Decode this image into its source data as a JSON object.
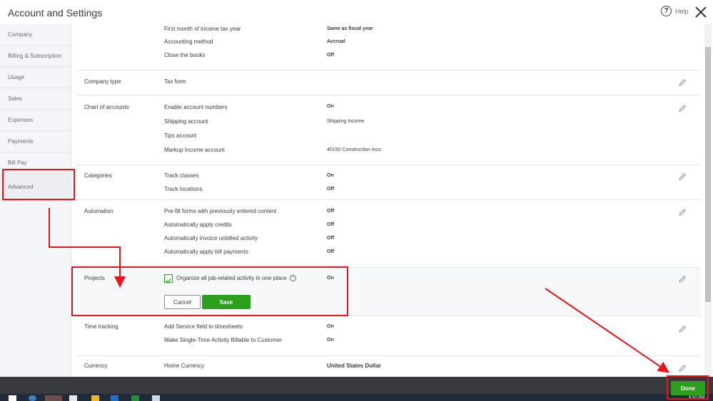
{
  "window": {
    "title": "Account and Settings",
    "help_label": "Help"
  },
  "sidebar": {
    "items": [
      {
        "label": "Company"
      },
      {
        "label": "Billing & Subscription"
      },
      {
        "label": "Usage"
      },
      {
        "label": "Sales"
      },
      {
        "label": "Expenses"
      },
      {
        "label": "Payments"
      },
      {
        "label": "Bill Pay"
      },
      {
        "label": "Advanced",
        "active": true
      }
    ]
  },
  "sections": {
    "accounting": {
      "rows": [
        {
          "label": "First month of income tax year",
          "value": "Same as fiscal year"
        },
        {
          "label": "Accounting method",
          "value": "Accrual"
        },
        {
          "label": "Close the books",
          "value": "Off"
        }
      ]
    },
    "company_type": {
      "label": "Company type",
      "rows": [
        {
          "label": "Tax form",
          "value": ""
        }
      ]
    },
    "chart_of_accounts": {
      "label": "Chart of accounts",
      "rows": [
        {
          "label": "Enable account numbers",
          "value": "On"
        },
        {
          "label": "Shipping account",
          "value": "Shipping Income"
        },
        {
          "label": "Tips account",
          "value": ""
        },
        {
          "label": "Markup income account",
          "value": "40150 Construction Inco"
        }
      ]
    },
    "categories": {
      "label": "Categories",
      "rows": [
        {
          "label": "Track classes",
          "value": "On"
        },
        {
          "label": "Track locations",
          "value": "Off"
        }
      ]
    },
    "automation": {
      "label": "Automation",
      "rows": [
        {
          "label": "Pre-fill forms with previously entered content",
          "value": "Off"
        },
        {
          "label": "Automatically apply credits",
          "value": "Off"
        },
        {
          "label": "Automatically invoice unbilled activity",
          "value": "Off"
        },
        {
          "label": "Automatically apply bill payments",
          "value": "Off"
        }
      ]
    },
    "projects": {
      "label": "Projects",
      "checkbox_label": "Organize all job-related activity in one place",
      "help_glyph": "?",
      "value": "On",
      "cancel_label": "Cancel",
      "save_label": "Save"
    },
    "time_tracking": {
      "label": "Time tracking",
      "rows": [
        {
          "label": "Add Service field to timesheets",
          "value": "On"
        },
        {
          "label": "Make Single-Time Activity Billable to Customer",
          "value": "On"
        }
      ]
    },
    "currency": {
      "label": "Currency",
      "rows": [
        {
          "label": "Home Currency",
          "value": "United States Dollar"
        }
      ]
    }
  },
  "footer": {
    "done_label": "Done",
    "clock": "9:50 PM"
  },
  "colors": {
    "accent_green": "#2ca01c",
    "annotation_red": "#e8151b",
    "footer_bg": "#393a3d"
  }
}
